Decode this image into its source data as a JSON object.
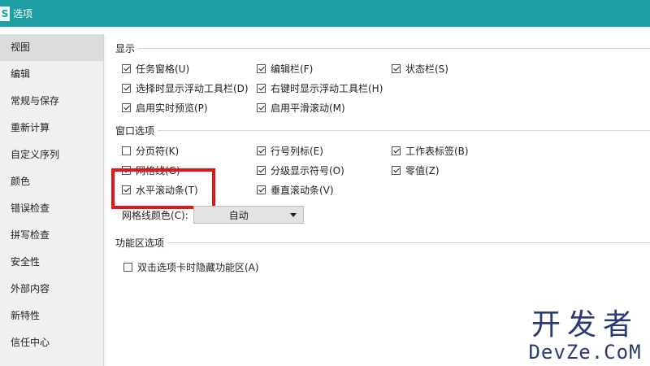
{
  "window": {
    "title": "选项",
    "app_icon_letter": "S"
  },
  "sidebar": {
    "items": [
      {
        "label": "视图",
        "selected": true
      },
      {
        "label": "编辑"
      },
      {
        "label": "常规与保存"
      },
      {
        "label": "重新计算"
      },
      {
        "label": "自定义序列"
      },
      {
        "label": "颜色"
      },
      {
        "label": "错误检查"
      },
      {
        "label": "拼写检查"
      },
      {
        "label": "安全性"
      },
      {
        "label": "外部内容"
      },
      {
        "label": "新特性"
      },
      {
        "label": "信任中心"
      }
    ]
  },
  "display": {
    "label": "显示",
    "options": {
      "task_pane": {
        "label": "任务窗格(U)",
        "checked": true
      },
      "formula_bar": {
        "label": "编辑栏(F)",
        "checked": true
      },
      "status_bar": {
        "label": "状态栏(S)",
        "checked": true
      },
      "float_toolbar_select": {
        "label": "选择时显示浮动工具栏(D)",
        "checked": true
      },
      "float_toolbar_rightclick": {
        "label": "右键时显示浮动工具栏(H)",
        "checked": true
      },
      "live_preview": {
        "label": "启用实时预览(P)",
        "checked": true
      },
      "smooth_scroll": {
        "label": "启用平滑滚动(M)",
        "checked": true
      }
    }
  },
  "window_options": {
    "label": "窗口选项",
    "options": {
      "page_break": {
        "label": "分页符(K)",
        "checked": false
      },
      "row_col_headers": {
        "label": "行号列标(E)",
        "checked": true
      },
      "sheet_tabs": {
        "label": "工作表标签(B)",
        "checked": true
      },
      "gridlines": {
        "label": "网格线(G)",
        "checked": true
      },
      "outline_symbols": {
        "label": "分级显示符号(O)",
        "checked": true
      },
      "zero_values": {
        "label": "零值(Z)",
        "checked": true
      },
      "horizontal_scroll": {
        "label": "水平滚动条(T)",
        "checked": true
      },
      "vertical_scroll": {
        "label": "垂直滚动条(V)",
        "checked": true
      }
    },
    "gridline_color": {
      "label": "网格线颜色(C):",
      "value": "自动"
    }
  },
  "ribbon_options": {
    "label": "功能区选项",
    "options": {
      "dblclick_hide": {
        "label": "双击选项卡时隐藏功能区(A)",
        "checked": false
      }
    }
  },
  "watermark": {
    "line1": "开发者",
    "line2": "DevZe.CoM"
  },
  "colors": {
    "titlebar": "#1e9fa3",
    "highlight": "#e5141a",
    "watermark": "#2a3b73"
  }
}
